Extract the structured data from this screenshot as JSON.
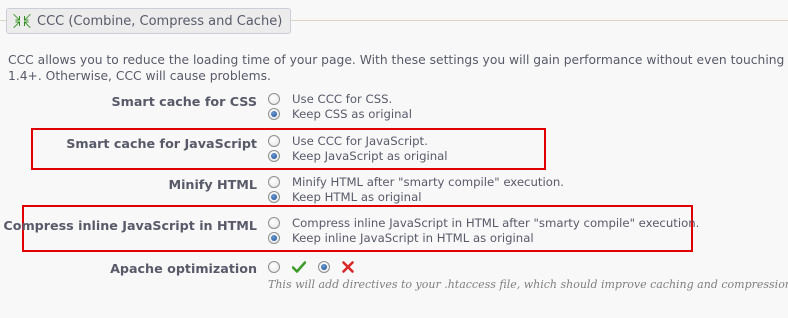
{
  "section": {
    "title": "CCC (Combine, Compress and Cache)",
    "icon": "compress-arrows-icon"
  },
  "intro": {
    "line1": "CCC allows you to reduce the loading time of your page. With these settings you will gain performance without even touching the code o",
    "line2": "1.4+. Otherwise, CCC will cause problems."
  },
  "settings": {
    "smart_css": {
      "label": "Smart cache for CSS",
      "options": [
        "Use CCC for CSS.",
        "Keep CSS as original"
      ],
      "selected": 1
    },
    "smart_js": {
      "label": "Smart cache for JavaScript",
      "options": [
        "Use CCC for JavaScript.",
        "Keep JavaScript as original"
      ],
      "selected": 1,
      "highlighted": true
    },
    "minify_html": {
      "label": "Minify HTML",
      "options": [
        "Minify HTML after \"smarty compile\" execution.",
        "Keep HTML as original"
      ],
      "selected": 1
    },
    "compress_inline_js": {
      "label": "Compress inline JavaScript in HTML",
      "options": [
        "Compress inline JavaScript in HTML after \"smarty compile\" execution.",
        "Keep inline JavaScript in HTML as original"
      ],
      "selected": 1,
      "highlighted": true
    },
    "apache": {
      "label": "Apache optimization",
      "yes_icon": "check-icon",
      "no_icon": "cross-icon",
      "selected": "no",
      "hint": "This will add directives to your .htaccess file, which should improve caching and compression."
    }
  },
  "colors": {
    "text": "#585a69",
    "highlight_border": "#e00000",
    "yes_icon": "#3f9b2c",
    "no_icon": "#d8282a",
    "background": "#f8f8f8"
  }
}
